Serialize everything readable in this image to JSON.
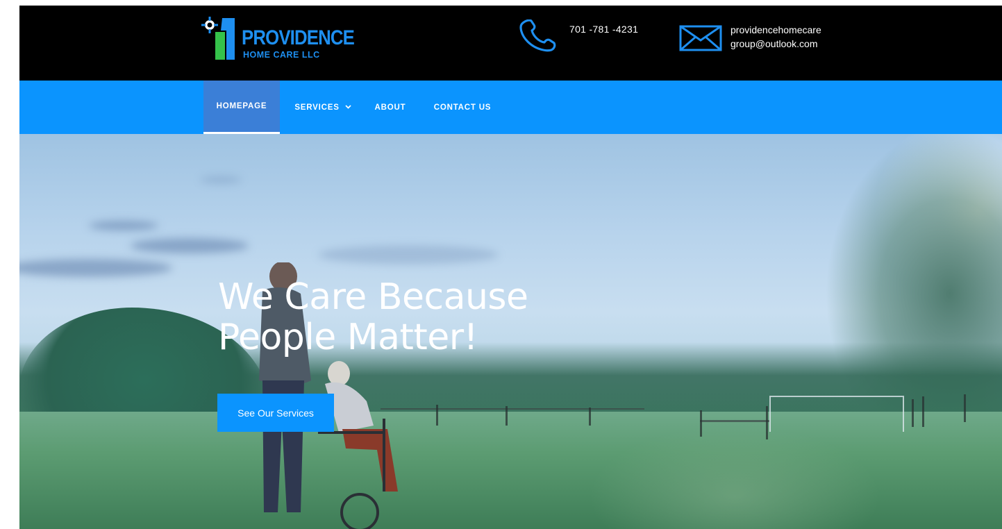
{
  "brand": {
    "name": "PROVIDENCE",
    "subtitle": "HOME CARE LLC",
    "accent_color": "#1e8ff0",
    "green_color": "#35c24a"
  },
  "contact": {
    "phone": "701 -781 -4231",
    "phone_icon": "phone-icon",
    "email_line1": "providencehomecare",
    "email_line2": "group@outlook.com",
    "email_icon": "mail-icon"
  },
  "nav": {
    "background_color": "#0b94fe",
    "items": [
      {
        "label": "HOMEPAGE",
        "active": true
      },
      {
        "label": "SERVICES",
        "has_dropdown": true,
        "dropdown_icon": "chevron-down-icon"
      },
      {
        "label": "ABOUT"
      },
      {
        "label": "CONTACT US"
      }
    ]
  },
  "hero": {
    "headline_line1": "We Care Because",
    "headline_line2": "People Matter!",
    "cta_label": "See Our Services",
    "cta_color": "#0b94fe"
  }
}
